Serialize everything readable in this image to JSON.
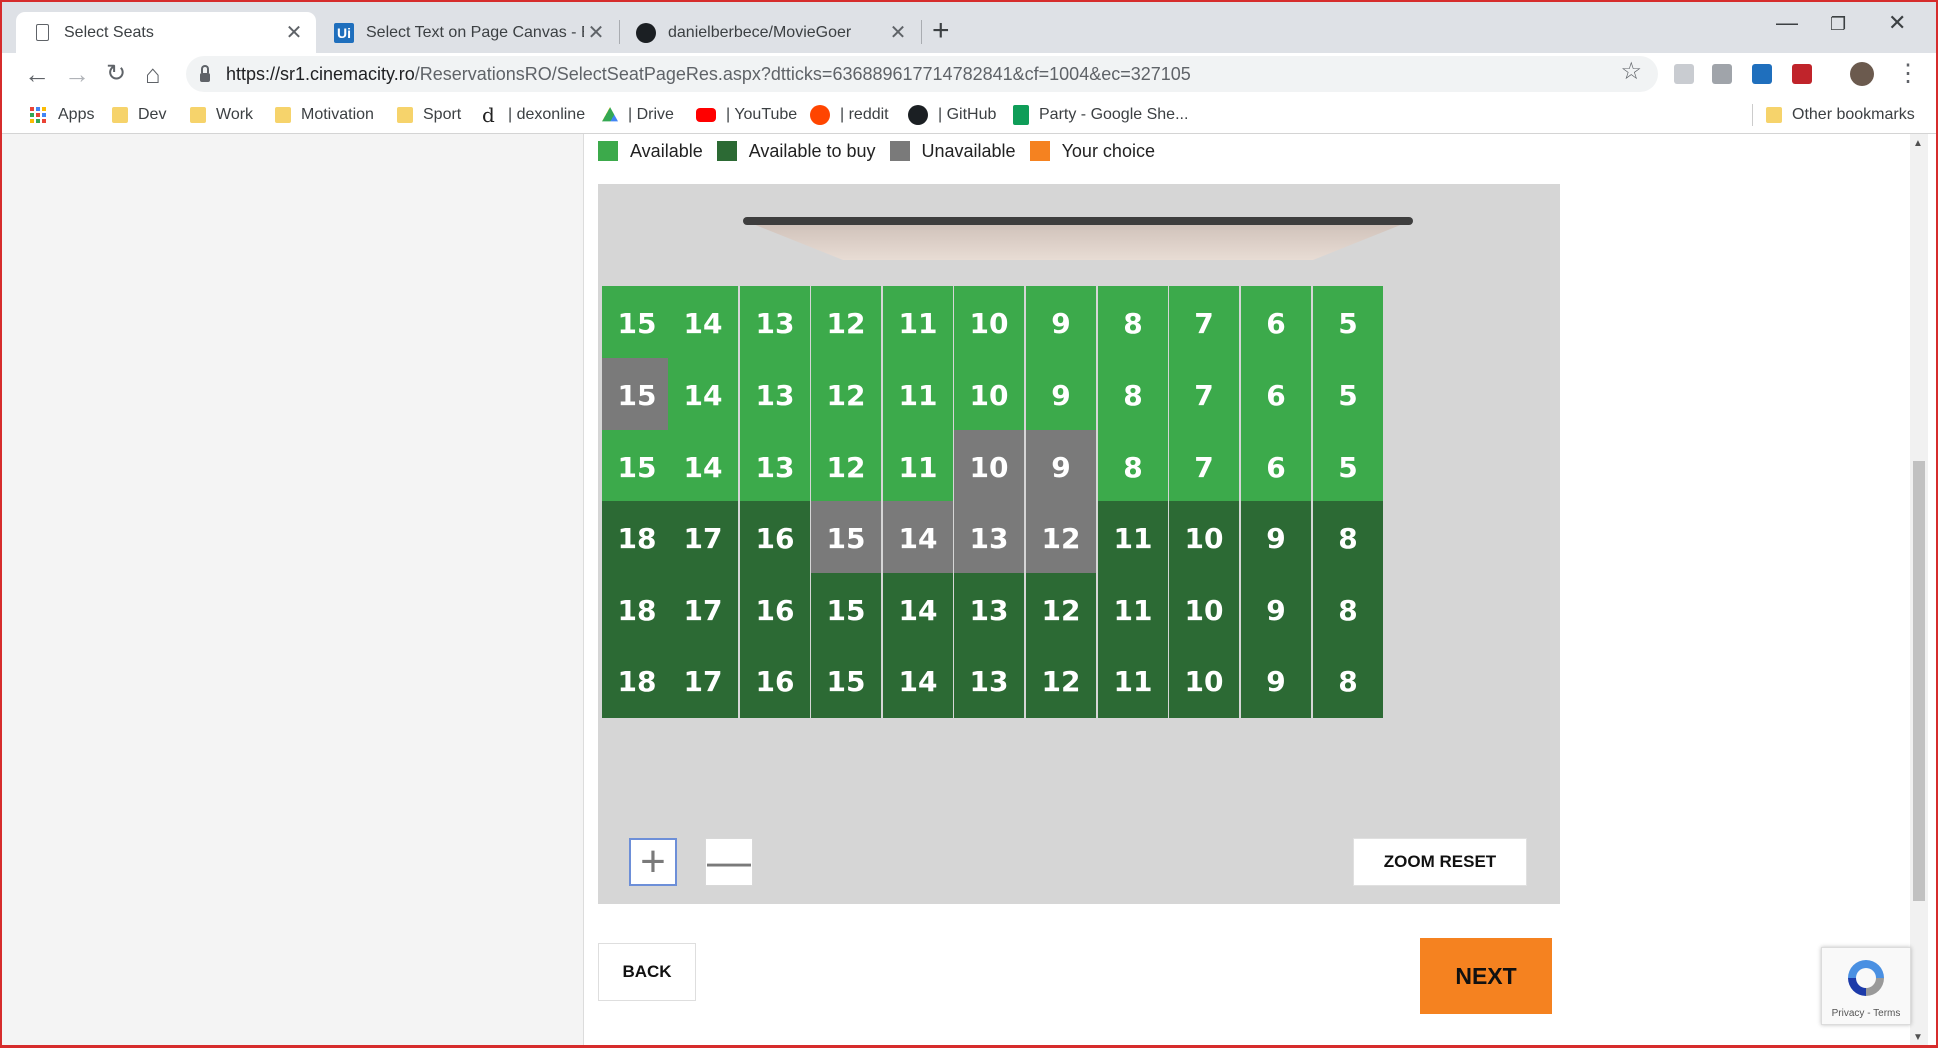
{
  "browser": {
    "tabs": [
      {
        "title": "Select Seats",
        "active": true,
        "icon": "page-icon"
      },
      {
        "title": "Select Text on Page Canvas - Basi",
        "active": false,
        "icon": "uipath-icon"
      },
      {
        "title": "danielberbece/MovieGoer",
        "active": false,
        "icon": "github-icon"
      }
    ],
    "tab_close_glyph": "✕",
    "new_tab_glyph": "+",
    "window_controls": {
      "minimize": "—",
      "restore": "❐",
      "close": "✕"
    },
    "url_host": "https://sr1.cinemacity.ro",
    "url_rest": "/ReservationsRO/SelectSeatPageRes.aspx?dtticks=636889617714782841&cf=1004&ec=327105",
    "bookmarks": [
      {
        "label": "Apps",
        "icon": "apps-grid-icon"
      },
      {
        "label": "Dev",
        "icon": "folder-icon"
      },
      {
        "label": "Work",
        "icon": "folder-icon"
      },
      {
        "label": "Motivation",
        "icon": "folder-icon"
      },
      {
        "label": "Sport",
        "icon": "folder-icon"
      },
      {
        "label": "| dexonline",
        "icon": "dexonline-icon"
      },
      {
        "label": "| Drive",
        "icon": "drive-icon"
      },
      {
        "label": "| YouTube",
        "icon": "youtube-icon"
      },
      {
        "label": "| reddit",
        "icon": "reddit-icon"
      },
      {
        "label": "| GitHub",
        "icon": "github-icon"
      },
      {
        "label": "Party - Google She...",
        "icon": "sheets-icon"
      }
    ],
    "other_bookmarks": "Other bookmarks"
  },
  "legend": [
    {
      "label": "Available",
      "color": "#3caa4b"
    },
    {
      "label": "Available to buy",
      "color": "#2c6a34"
    },
    {
      "label": "Unavailable",
      "color": "#7a7a7a"
    },
    {
      "label": "Your choice",
      "color": "#f58220"
    }
  ],
  "status_colors": {
    "available": "#3caa4b",
    "to_buy": "#2c6a34",
    "unavailable": "#7a7a7a"
  },
  "seat_rows": [
    {
      "seats": [
        [
          "15",
          "available"
        ],
        [
          "14",
          "available"
        ],
        [
          "13",
          "available"
        ],
        [
          "12",
          "available"
        ],
        [
          "11",
          "available"
        ],
        [
          "10",
          "available"
        ],
        [
          "9",
          "available"
        ],
        [
          "8",
          "available"
        ],
        [
          "7",
          "available"
        ],
        [
          "6",
          "available"
        ],
        [
          "5",
          "available"
        ]
      ]
    },
    {
      "seats": [
        [
          "15",
          "unavailable"
        ],
        [
          "14",
          "available"
        ],
        [
          "13",
          "available"
        ],
        [
          "12",
          "available"
        ],
        [
          "11",
          "available"
        ],
        [
          "10",
          "available"
        ],
        [
          "9",
          "available"
        ],
        [
          "8",
          "available"
        ],
        [
          "7",
          "available"
        ],
        [
          "6",
          "available"
        ],
        [
          "5",
          "available"
        ]
      ]
    },
    {
      "seats": [
        [
          "15",
          "available"
        ],
        [
          "14",
          "available"
        ],
        [
          "13",
          "available"
        ],
        [
          "12",
          "available"
        ],
        [
          "11",
          "available"
        ],
        [
          "10",
          "unavailable"
        ],
        [
          "9",
          "unavailable"
        ],
        [
          "8",
          "available"
        ],
        [
          "7",
          "available"
        ],
        [
          "6",
          "available"
        ],
        [
          "5",
          "available"
        ]
      ]
    },
    {
      "seats": [
        [
          "18",
          "to_buy"
        ],
        [
          "17",
          "to_buy"
        ],
        [
          "16",
          "to_buy"
        ],
        [
          "15",
          "unavailable"
        ],
        [
          "14",
          "unavailable"
        ],
        [
          "13",
          "unavailable"
        ],
        [
          "12",
          "unavailable"
        ],
        [
          "11",
          "to_buy"
        ],
        [
          "10",
          "to_buy"
        ],
        [
          "9",
          "to_buy"
        ],
        [
          "8",
          "to_buy"
        ]
      ]
    },
    {
      "seats": [
        [
          "18",
          "to_buy"
        ],
        [
          "17",
          "to_buy"
        ],
        [
          "16",
          "to_buy"
        ],
        [
          "15",
          "to_buy"
        ],
        [
          "14",
          "to_buy"
        ],
        [
          "13",
          "to_buy"
        ],
        [
          "12",
          "to_buy"
        ],
        [
          "11",
          "to_buy"
        ],
        [
          "10",
          "to_buy"
        ],
        [
          "9",
          "to_buy"
        ],
        [
          "8",
          "to_buy"
        ]
      ]
    },
    {
      "seats": [
        [
          "18",
          "to_buy"
        ],
        [
          "17",
          "to_buy"
        ],
        [
          "16",
          "to_buy"
        ],
        [
          "15",
          "to_buy"
        ],
        [
          "14",
          "to_buy"
        ],
        [
          "13",
          "to_buy"
        ],
        [
          "12",
          "to_buy"
        ],
        [
          "11",
          "to_buy"
        ],
        [
          "10",
          "to_buy"
        ],
        [
          "9",
          "to_buy"
        ],
        [
          "8",
          "to_buy"
        ]
      ]
    }
  ],
  "controls": {
    "zoom_in": "+",
    "zoom_out": "—",
    "zoom_reset": "ZOOM RESET",
    "back": "BACK",
    "next": "NEXT"
  },
  "recaptcha": {
    "terms": "Privacy - Terms"
  }
}
